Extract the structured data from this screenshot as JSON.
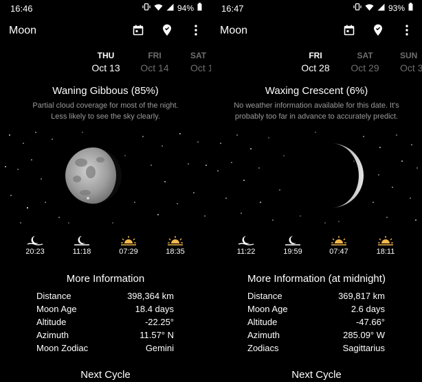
{
  "left": {
    "status": {
      "time": "16:46",
      "battery": "94%"
    },
    "app_title": "Moon",
    "days": [
      {
        "dow": "THU",
        "date": "Oct 13",
        "selected": true
      },
      {
        "dow": "FRI",
        "date": "Oct 14",
        "selected": false
      },
      {
        "dow": "SAT",
        "date": "Oct 1",
        "selected": false
      }
    ],
    "phase": "Waning Gibbous (85%)",
    "weather": "Partial cloud coverage for most of the night. Less likely to see the sky clearly.",
    "events": [
      {
        "icon": "moonrise-icon",
        "time": "20:23"
      },
      {
        "icon": "moonset-icon",
        "time": "11:18"
      },
      {
        "icon": "sunrise-icon",
        "time": "07:29"
      },
      {
        "icon": "sunset-icon",
        "time": "18:35"
      }
    ],
    "info_title": "More Information",
    "info": [
      {
        "key": "Distance",
        "value": "398,364 km"
      },
      {
        "key": "Moon Age",
        "value": "18.4 days"
      },
      {
        "key": "Altitude",
        "value": "-22.25°"
      },
      {
        "key": "Azimuth",
        "value": "11.57° N"
      },
      {
        "key": "Moon Zodiac",
        "value": "Gemini"
      }
    ],
    "next": "Next Cycle"
  },
  "right": {
    "status": {
      "time": "16:47",
      "battery": "93%"
    },
    "app_title": "Moon",
    "days": [
      {
        "dow": "FRI",
        "date": "Oct 28",
        "selected": true
      },
      {
        "dow": "SAT",
        "date": "Oct 29",
        "selected": false
      },
      {
        "dow": "SUN",
        "date": "Oct 3",
        "selected": false
      }
    ],
    "phase": "Waxing Crescent (6%)",
    "weather": "No weather information available for this date. It's probably too far in advance to accurately predict.",
    "events": [
      {
        "icon": "moonrise-icon",
        "time": "11:22"
      },
      {
        "icon": "moonset-icon",
        "time": "19:59"
      },
      {
        "icon": "sunrise-icon",
        "time": "07:47"
      },
      {
        "icon": "sunset-icon",
        "time": "18:11"
      }
    ],
    "info_title": "More Information (at midnight)",
    "info": [
      {
        "key": "Distance",
        "value": "369,817 km"
      },
      {
        "key": "Moon Age",
        "value": "2.6 days"
      },
      {
        "key": "Altitude",
        "value": "-47.66°"
      },
      {
        "key": "Azimuth",
        "value": "285.09° W"
      },
      {
        "key": "Zodiacs",
        "value": "Sagittarius"
      }
    ],
    "next": "Next Cycle"
  },
  "colors": {
    "background": "#000000",
    "dim_text": "#6f6f6f",
    "sun_accent": "#f2b84b"
  }
}
